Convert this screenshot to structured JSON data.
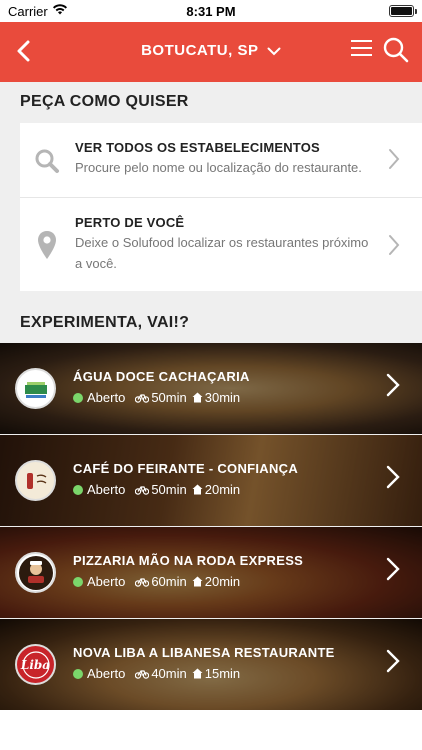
{
  "status_bar": {
    "carrier": "Carrier",
    "time": "8:31 PM"
  },
  "navbar": {
    "title": "BOTUCATU, SP",
    "icons": [
      "back-icon",
      "chevron-down-icon",
      "menu-icon",
      "search-icon"
    ],
    "color": "#e94b3c"
  },
  "order_section": {
    "title": "PEÇA COMO QUISER",
    "options": [
      {
        "icon": "search-icon",
        "title": "VER TODOS OS ESTABELECIMENTOS",
        "desc": "Procure pelo nome ou localização do restaurante."
      },
      {
        "icon": "location-pin-icon",
        "title": "PERTO DE VOCÊ",
        "desc": "Deixe o Solufood localizar os restaurantes próximo a você."
      }
    ]
  },
  "experiment_section": {
    "title": "EXPERIMENTA, VAI!?",
    "restaurants": [
      {
        "name": "ÁGUA DOCE CACHAÇARIA",
        "status": "Aberto",
        "delivery": "50min",
        "pickup": "30min"
      },
      {
        "name": "CAFÉ DO FEIRANTE - CONFIANÇA",
        "status": "Aberto",
        "delivery": "50min",
        "pickup": "20min"
      },
      {
        "name": "PIZZARIA MÃO NA RODA EXPRESS",
        "status": "Aberto",
        "delivery": "60min",
        "pickup": "20min"
      },
      {
        "name": "NOVA LIBA A LIBANESA RESTAURANTE",
        "status": "Aberto",
        "delivery": "40min",
        "pickup": "15min"
      }
    ],
    "logo_texts": [
      "Liba"
    ]
  },
  "colors": {
    "accent": "#e94b3c",
    "open_status": "#7bd66b"
  }
}
